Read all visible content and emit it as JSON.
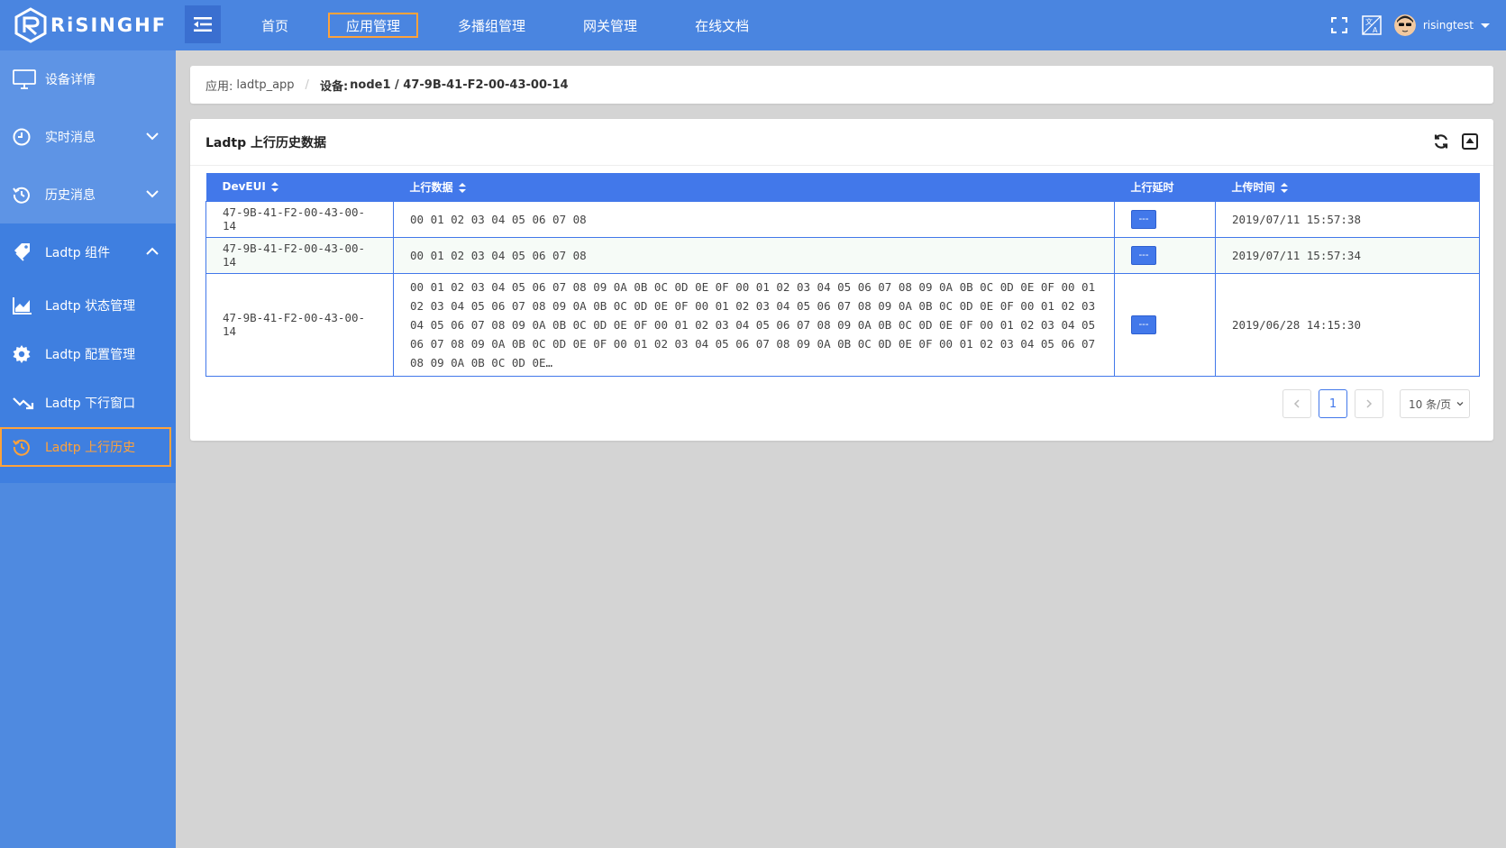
{
  "app": {
    "logo_text": "RiSINGHF"
  },
  "nav": {
    "items": [
      {
        "label": "首页",
        "active": false
      },
      {
        "label": "应用管理",
        "active": true
      },
      {
        "label": "多播组管理",
        "active": false
      },
      {
        "label": "网关管理",
        "active": false
      },
      {
        "label": "在线文档",
        "active": false
      }
    ]
  },
  "user": {
    "name": "risingtest"
  },
  "sidebar": {
    "items": [
      {
        "label": "设备详情",
        "icon": "monitor-icon"
      },
      {
        "label": "实时消息",
        "icon": "clock-icon",
        "chevron": "down"
      },
      {
        "label": "历史消息",
        "icon": "history-icon",
        "chevron": "down"
      },
      {
        "label": "Ladtp 组件",
        "icon": "tag-icon",
        "chevron": "up"
      }
    ],
    "sub_items": [
      {
        "label": "Ladtp 状态管理",
        "icon": "area-chart-icon"
      },
      {
        "label": "Ladtp 配置管理",
        "icon": "gear-icon"
      },
      {
        "label": "Ladtp 下行窗口",
        "icon": "trend-down-icon"
      },
      {
        "label": "Ladtp 上行历史",
        "icon": "history-icon",
        "selected": true
      }
    ]
  },
  "breadcrumb": {
    "app_label": "应用:",
    "app_value": "ladtp_app",
    "device_label": "设备:",
    "device_value": "node1 / 47-9B-41-F2-00-43-00-14"
  },
  "card": {
    "title": "Ladtp 上行历史数据"
  },
  "table": {
    "columns": [
      "DevEUI",
      "上行数据",
      "上行延时",
      "上传时间"
    ],
    "rows": [
      {
        "deveui": "47-9B-41-F2-00-43-00-14",
        "data": "00 01 02 03 04 05 06 07 08",
        "delay": "---",
        "time": "2019/07/11 15:57:38"
      },
      {
        "deveui": "47-9B-41-F2-00-43-00-14",
        "data": "00 01 02 03 04 05 06 07 08",
        "delay": "---",
        "time": "2019/07/11 15:57:34"
      },
      {
        "deveui": "47-9B-41-F2-00-43-00-14",
        "data": "00 01 02 03 04 05 06 07 08 09 0A 0B 0C 0D 0E 0F 00 01 02 03 04 05 06 07 08 09 0A 0B 0C 0D 0E 0F 00 01 02 03 04 05 06 07 08 09 0A 0B 0C 0D 0E 0F 00 01 02 03 04 05 06 07 08 09 0A 0B 0C 0D 0E 0F 00 01 02 03 04 05 06 07 08 09 0A 0B 0C 0D 0E 0F 00 01 02 03 04 05 06 07 08 09 0A 0B 0C 0D 0E 0F 00 01 02 03 04 05 06 07 08 09 0A 0B 0C 0D 0E 0F 00 01 02 03 04 05 06 07 08 09 0A 0B 0C 0D 0E 0F 00 01 02 03 04 05 06 07 08 09 0A 0B 0C 0D 0E…",
        "delay": "---",
        "time": "2019/06/28 14:15:30"
      }
    ]
  },
  "pagination": {
    "current_page": "1",
    "page_size": "10 条/页"
  },
  "colors": {
    "topbar": "#4a85e0",
    "sidebar": "#4f8ae0",
    "accent": "#ffa23a",
    "table_header": "#4278ea"
  }
}
